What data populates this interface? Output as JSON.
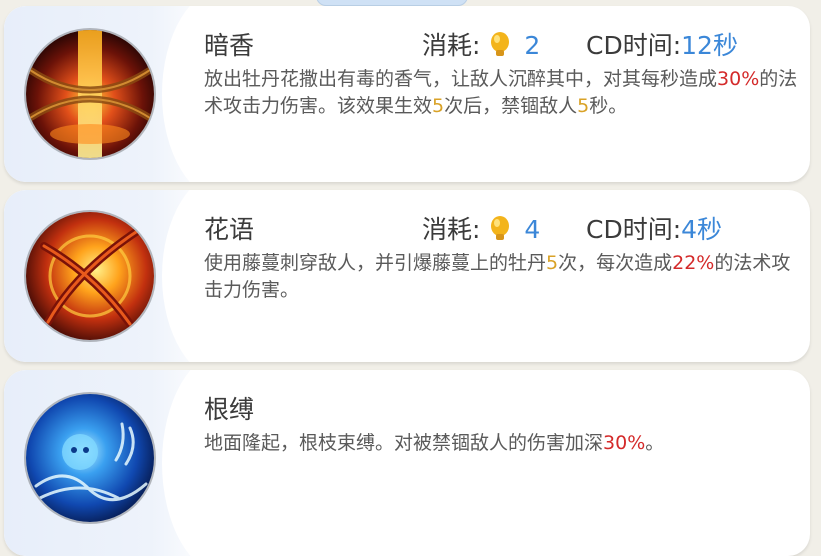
{
  "skills": [
    {
      "name": "暗香",
      "cost_label": "消耗:",
      "cost_value": "2",
      "cd_label": "CD时间:",
      "cd_value": "12秒",
      "desc_parts": [
        {
          "text": "放出牡丹花撒出有毒的香气，让敌人沉醉其中，对其每秒造成",
          "style": "normal"
        },
        {
          "text": "30%",
          "style": "red"
        },
        {
          "text": "的法术攻击力伤害。该效果生效",
          "style": "normal"
        },
        {
          "text": "5",
          "style": "gold"
        },
        {
          "text": "次后，禁锢敌人",
          "style": "normal"
        },
        {
          "text": "5",
          "style": "gold"
        },
        {
          "text": "秒。",
          "style": "normal"
        }
      ],
      "icon": "chained-fire-pillar-icon"
    },
    {
      "name": "花语",
      "cost_label": "消耗:",
      "cost_value": "4",
      "cd_label": "CD时间:",
      "cd_value": "4秒",
      "desc_parts": [
        {
          "text": "使用藤蔓刺穿敌人，并引爆藤蔓上的牡丹",
          "style": "normal"
        },
        {
          "text": "5",
          "style": "gold"
        },
        {
          "text": "次，每次造成",
          "style": "normal"
        },
        {
          "text": "22%",
          "style": "red"
        },
        {
          "text": "的法术攻击力伤害。",
          "style": "normal"
        }
      ],
      "icon": "fire-orb-vines-icon"
    },
    {
      "name": "根缚",
      "desc_parts": [
        {
          "text": "地面隆起，根枝束缚。对被禁锢敌人的伤害加深",
          "style": "normal"
        },
        {
          "text": "30%",
          "style": "red"
        },
        {
          "text": "。",
          "style": "normal"
        }
      ],
      "icon": "blue-root-bind-icon"
    }
  ],
  "colors": {
    "number_blue": "#3b87d8",
    "highlight_red": "#d42a2a",
    "highlight_gold": "#d9a227",
    "text": "#3b3b3b"
  }
}
